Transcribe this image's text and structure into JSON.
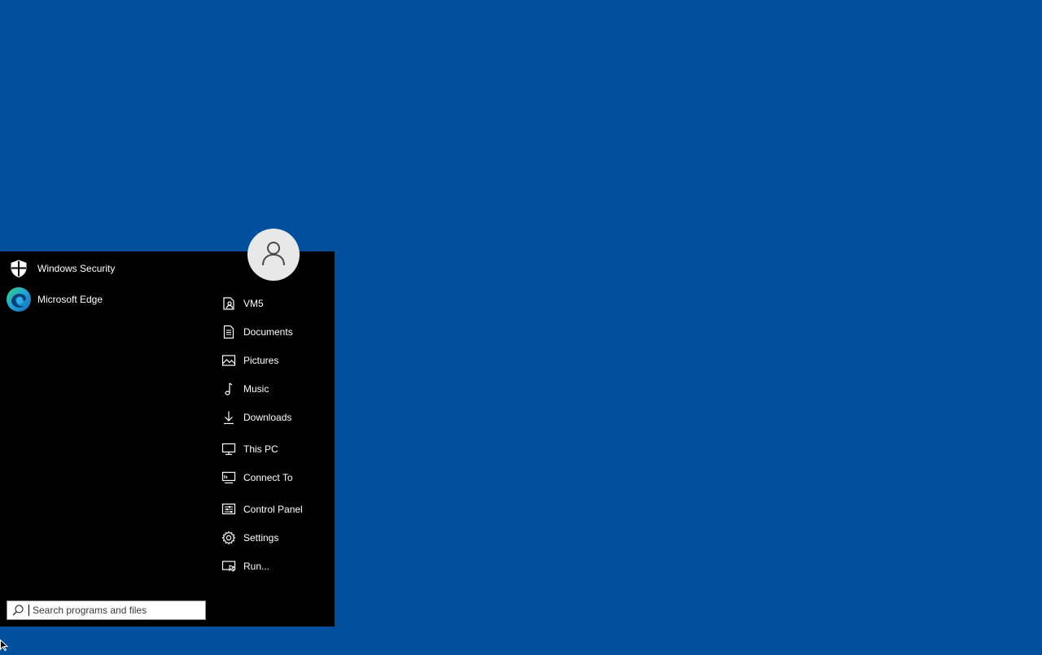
{
  "desktop": {
    "background_color": "#00509e"
  },
  "start_menu": {
    "background_color": "#000000",
    "pinned": [
      {
        "label": "Windows Security",
        "icon": "shield-icon"
      },
      {
        "label": "Microsoft Edge",
        "icon": "edge-icon"
      }
    ],
    "user": {
      "icon": "user-icon"
    },
    "places": [
      {
        "label": "VM5",
        "icon": "user-folder-icon"
      },
      {
        "label": "Documents",
        "icon": "document-icon"
      },
      {
        "label": "Pictures",
        "icon": "picture-icon"
      },
      {
        "label": "Music",
        "icon": "music-icon"
      },
      {
        "label": "Downloads",
        "icon": "download-icon"
      },
      {
        "label": "This PC",
        "icon": "computer-icon"
      },
      {
        "label": "Connect To",
        "icon": "connect-icon"
      },
      {
        "label": "Control Panel",
        "icon": "control-panel-icon"
      },
      {
        "label": "Settings",
        "icon": "gear-icon"
      },
      {
        "label": "Run...",
        "icon": "run-icon"
      }
    ],
    "search": {
      "placeholder": "Search programs and files",
      "value": ""
    }
  }
}
